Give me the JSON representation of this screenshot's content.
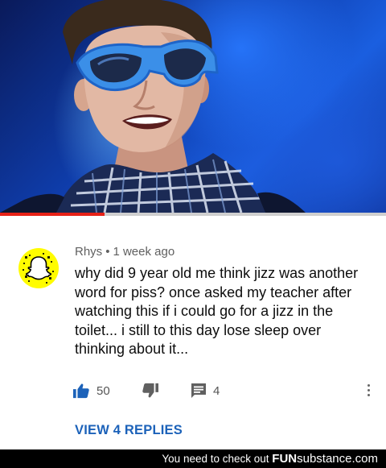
{
  "video": {
    "progress": 0.27,
    "accent": "#e62117",
    "thumbnail_icon": "man-sunglasses-scarf-image"
  },
  "comment": {
    "author": "Rhys",
    "separator": "•",
    "time": "1 week ago",
    "text": "why did 9 year old me think jizz was another word for piss? once asked my teacher after watching this if i could go for a jizz in the toilet... i still to this day lose sleep over thinking about it...",
    "avatar_icon": "snapchat-ghost-icon",
    "likes": "50",
    "replies_count": "4",
    "view_replies_label": "VIEW 4 REPLIES",
    "link_color": "#1c62b9",
    "like_color": "#1c62b9"
  },
  "footer": {
    "prefix": "You need to check out",
    "brand_bold": "FUN",
    "brand_rest": "substance.com"
  }
}
